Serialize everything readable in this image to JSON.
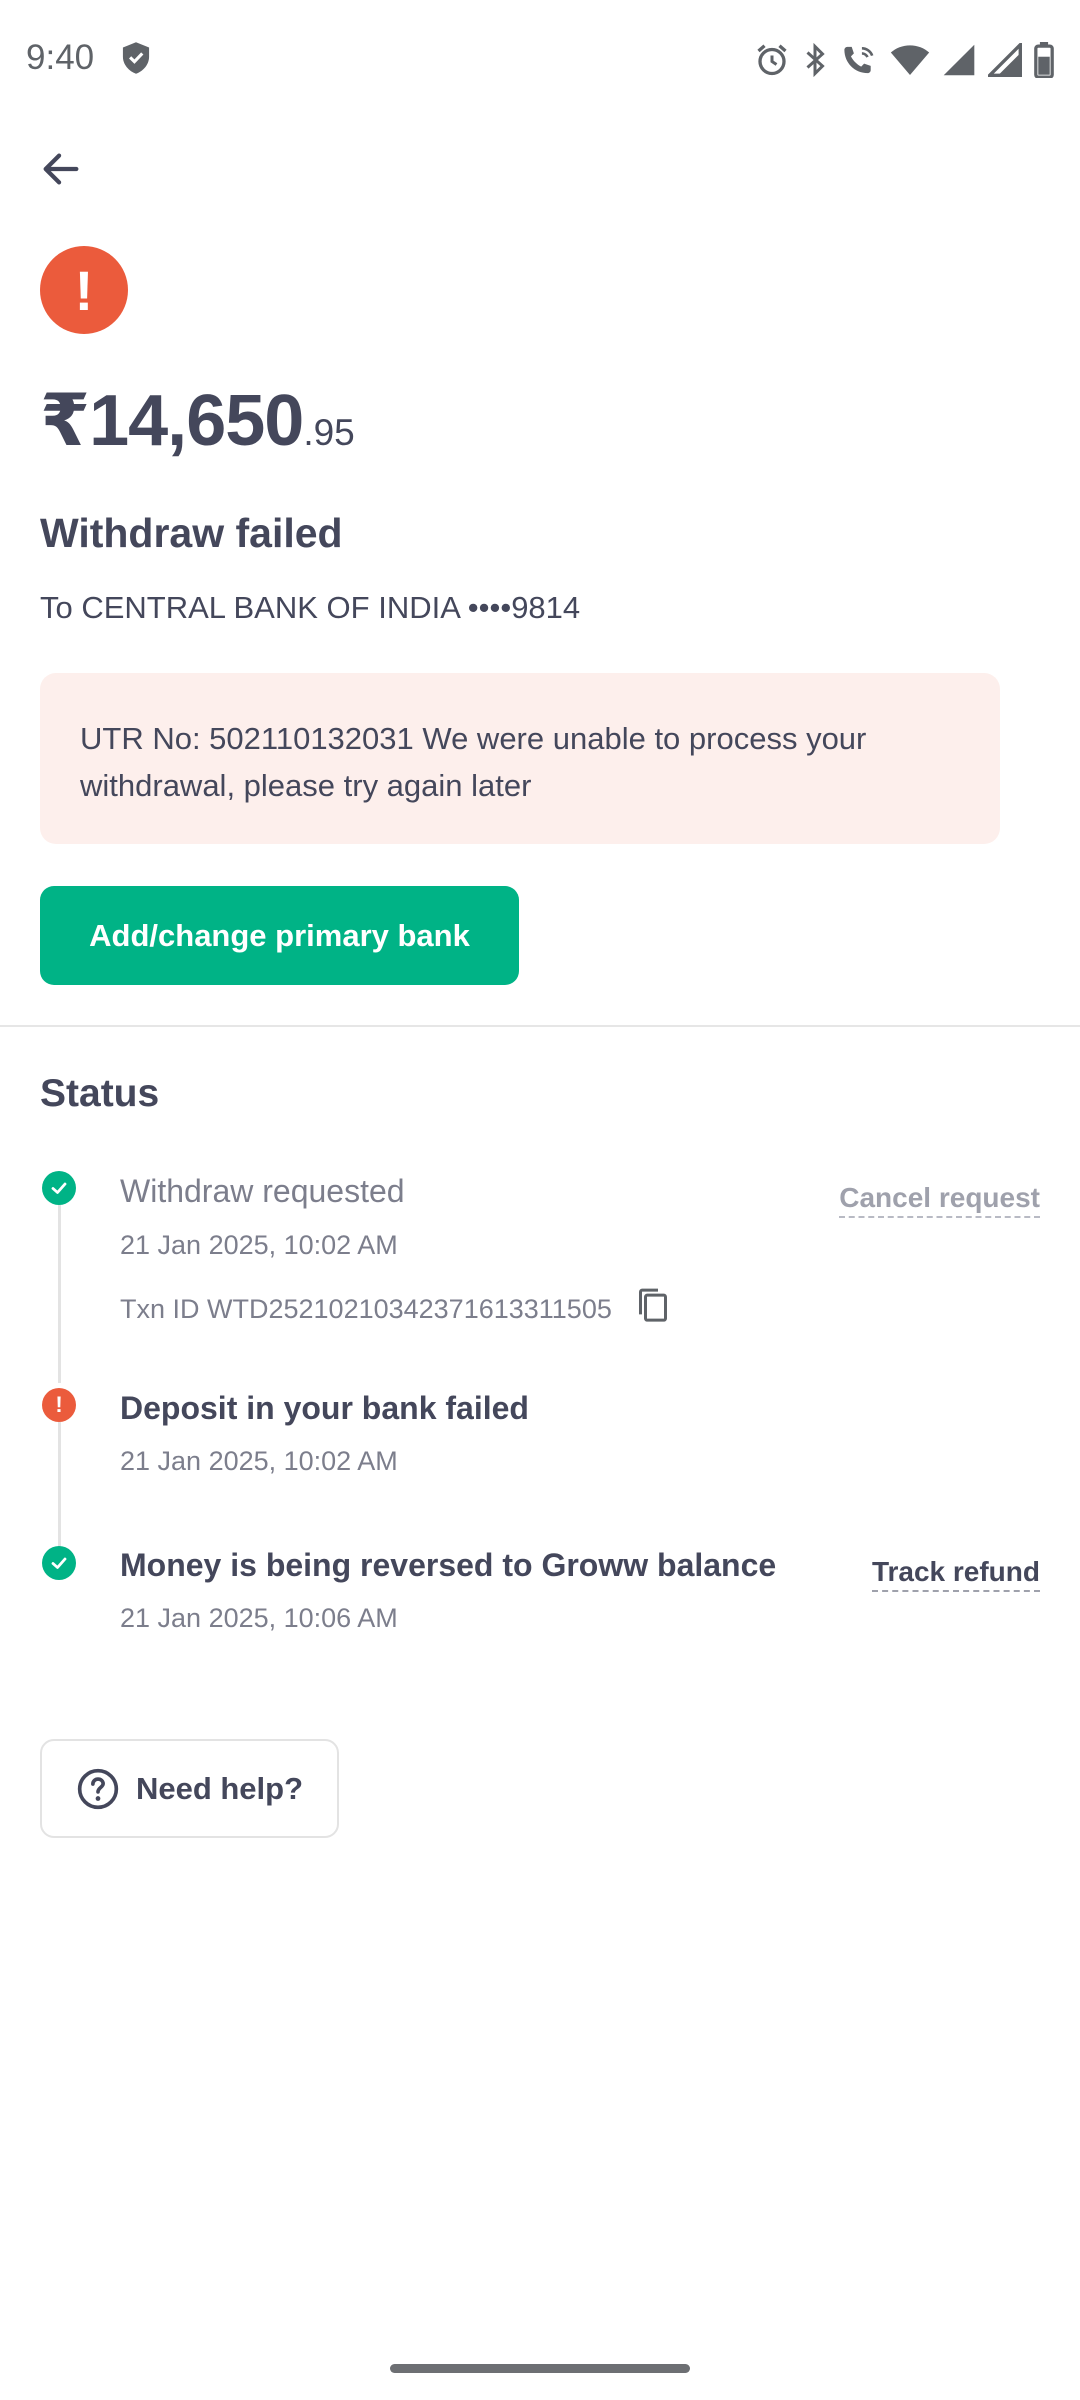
{
  "status_bar": {
    "time": "9:40",
    "icons": [
      "shield-icon",
      "alarm-icon",
      "bluetooth-icon",
      "wifi-calling-icon",
      "wifi-icon",
      "signal-icon",
      "signal-icon",
      "battery-icon"
    ]
  },
  "header": {
    "back_icon": "arrow-left-icon"
  },
  "summary": {
    "alert_symbol": "!",
    "amount_main": "₹14,650",
    "amount_paise": ".95",
    "title": "Withdraw failed",
    "destination": "To CENTRAL BANK OF INDIA ••••9814",
    "error_message": "UTR No: 502110132031 We were unable to process your withdrawal, please try again later",
    "primary_button": "Add/change primary bank"
  },
  "status": {
    "heading": "Status",
    "steps": [
      {
        "title": "Withdraw requested",
        "date": "21 Jan 2025, 10:02 AM",
        "txn": "Txn ID WTD252102103423716133115​05",
        "action": "Cancel request",
        "state": "done"
      },
      {
        "title": "Deposit in your bank failed",
        "date": "21 Jan 2025, 10:02 AM",
        "state": "failed",
        "symbol": "!"
      },
      {
        "title": "Money is being reversed to Groww balance",
        "date": "21 Jan 2025, 10:06 AM",
        "action": "Track refund",
        "state": "done"
      }
    ]
  },
  "help": {
    "label": "Need help?",
    "icon": "help-circle-icon"
  },
  "colors": {
    "accent": "#00b386",
    "error": "#eb5b3c",
    "error_bg": "#fdefec",
    "text": "#44475b",
    "muted": "#7c7e8c"
  }
}
